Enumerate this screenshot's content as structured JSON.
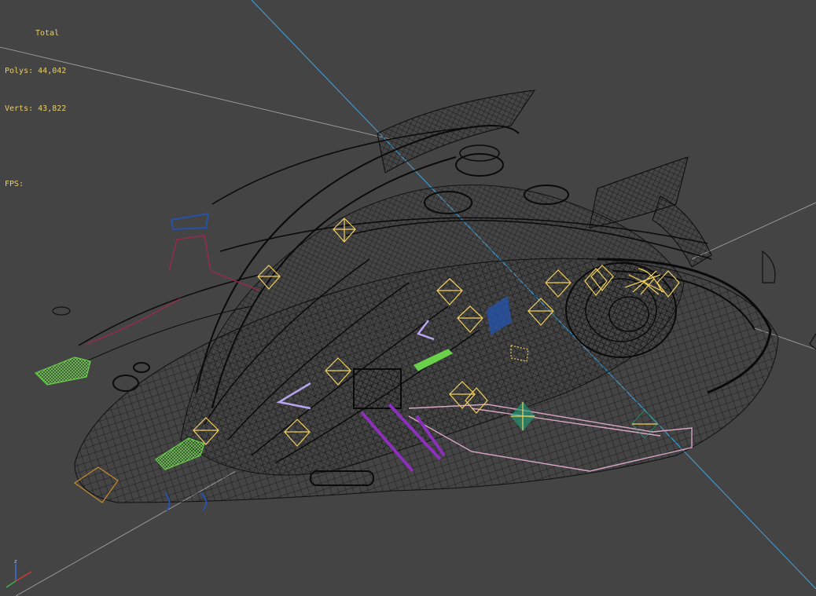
{
  "viewport": {
    "background_color": "#444444",
    "stats": {
      "total_label": "Total",
      "polys_label": "Polys:",
      "polys_value": "44,042",
      "verts_label": "Verts:",
      "verts_value": "43,822",
      "fps_label": "FPS:",
      "fps_value": "",
      "text_color": "#e8cf6a"
    },
    "axis_gizmo": {
      "axes": [
        "x",
        "y",
        "z"
      ],
      "z_label": "z"
    },
    "colors": {
      "wireframe": "#0a0a0a",
      "grid_line": "#a9a9a9",
      "view_axis": "#3fa3e0",
      "helper": "#f3d15d",
      "green_mesh": "#6ad24a",
      "purple_mesh": "#8c2fbd",
      "lilac_mesh": "#b7a6f2",
      "blue_mesh": "#2553a8",
      "pink_trim": "#d9a6c4",
      "red_trim": "#9a2a4a",
      "teal_helper": "#1fa37a"
    },
    "icons": [
      "axis-gizmo-icon",
      "light-helper-icon",
      "camera-icon"
    ]
  }
}
